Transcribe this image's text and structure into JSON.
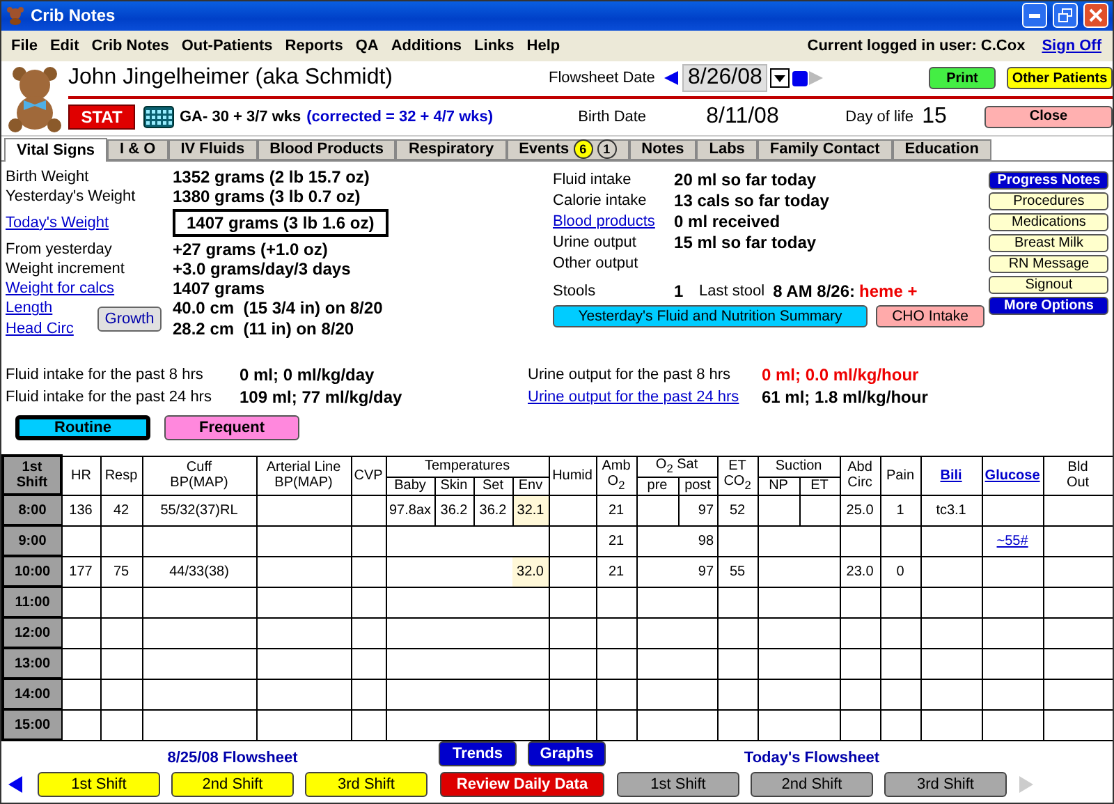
{
  "window": {
    "title": "Crib Notes"
  },
  "menu": {
    "items": [
      "File",
      "Edit",
      "Crib Notes",
      "Out-Patients",
      "Reports",
      "QA",
      "Additions",
      "Links",
      "Help"
    ],
    "user": "Current logged in user: C.Cox",
    "sign_off": "Sign Off"
  },
  "patient": {
    "name": "John Jingelheimer (aka Schmidt)",
    "stat": "STAT",
    "ga": "GA- 30 + 3/7 wks",
    "corrected": "(corrected = 32 + 4/7 wks)",
    "flowsheet_label": "Flowsheet Date",
    "flowsheet_date": "8/26/08",
    "birth_label": "Birth Date",
    "birth_date": "8/11/08",
    "dol_label": "Day of life",
    "dol": "15",
    "print": "Print",
    "other_patients": "Other Patients",
    "close": "Close"
  },
  "tabs": [
    {
      "label": "Vital Signs",
      "selected": true
    },
    {
      "label": "I & O",
      "selected": false
    },
    {
      "label": "IV Fluids",
      "selected": false
    },
    {
      "label": "Blood Products",
      "selected": false
    },
    {
      "label": "Respiratory",
      "selected": false
    },
    {
      "label": "Events",
      "selected": false,
      "badges": [
        {
          "text": "6",
          "color": "#ffff00"
        },
        {
          "text": "1",
          "color": "#d4d0c8"
        }
      ]
    },
    {
      "label": "Notes",
      "selected": false
    },
    {
      "label": "Labs",
      "selected": false
    },
    {
      "label": "Family Contact",
      "selected": false
    },
    {
      "label": "Education",
      "selected": false
    }
  ],
  "weights": [
    {
      "label": "Birth Weight",
      "value": "1352 grams (2 lb 15.7 oz)",
      "link": false,
      "boxed": false
    },
    {
      "label": "Yesterday's Weight",
      "value": "1380 grams (3 lb 0.7 oz)",
      "link": false,
      "boxed": false
    },
    {
      "label": "Today's Weight",
      "value": "1407 grams (3 lb 1.6 oz)",
      "link": true,
      "boxed": true
    },
    {
      "label": "From yesterday",
      "value": "+27 grams (+1.0 oz)",
      "link": false,
      "boxed": false
    },
    {
      "label": "Weight increment",
      "value": "+3.0 grams/day/3 days",
      "link": false,
      "boxed": false
    },
    {
      "label": "Weight for calcs",
      "value": "1407 grams",
      "link": true,
      "boxed": false
    }
  ],
  "measurements": {
    "button": "Growth",
    "rows": [
      {
        "label": "Length",
        "value": "40.0 cm  (15 3/4 in) on 8/20"
      },
      {
        "label": "Head Circ",
        "value": "28.2 cm  (11 in) on 8/20"
      }
    ]
  },
  "intake": [
    {
      "label": "Fluid intake",
      "value": "20 ml so far today",
      "link": false
    },
    {
      "label": "Calorie intake",
      "value": "13 cals so far today",
      "link": false
    },
    {
      "label": "Blood products",
      "value": "0 ml received",
      "link": true
    },
    {
      "label": "Urine output",
      "value": "15 ml so far today",
      "link": false
    },
    {
      "label": "Other output",
      "link": false
    }
  ],
  "stools": {
    "label": "Stools",
    "count": "1",
    "last_label": "Last stool",
    "last_time": "8 AM 8/26:",
    "last_note": "heme +"
  },
  "summary_buttons": [
    {
      "label": "Yesterday's Fluid and Nutrition Summary",
      "color": "#00ccff"
    },
    {
      "label": "CHO Intake",
      "color": "#ffaaaa"
    }
  ],
  "side_buttons": [
    {
      "label": "Progress Notes",
      "color": "#0000cc"
    },
    {
      "label": "Procedures",
      "color": "#ffffcc"
    },
    {
      "label": "Medications",
      "color": "#ffffcc"
    },
    {
      "label": "Breast Milk",
      "color": "#ffffcc"
    },
    {
      "label": "RN Message",
      "color": "#ffffcc"
    },
    {
      "label": "Signout",
      "color": "#ffffcc"
    },
    {
      "label": "More Options",
      "color": "#0000cc"
    }
  ],
  "totals": [
    {
      "label": "Fluid intake for the past 8 hrs",
      "value": "0 ml; 0 ml/kg/day",
      "link": false,
      "alert": false
    },
    {
      "label": "Urine output for the past 8 hrs",
      "value": "0 ml; 0.0 ml/kg/hour",
      "link": false,
      "alert": true
    },
    {
      "label": "Fluid intake for the past 24 hrs",
      "value": "109 ml; 77 ml/kg/day",
      "link": false,
      "alert": false
    },
    {
      "label": "Urine output for the past 24 hrs",
      "value": "61 ml; 1.8 ml/kg/hour",
      "link": true,
      "alert": false
    }
  ],
  "modes": [
    {
      "label": "Routine",
      "color": "#00ccff",
      "selected": true
    },
    {
      "label": "Frequent",
      "color": "#ff88dd",
      "selected": false
    }
  ],
  "table": {
    "columns": [
      {
        "label": "HR"
      },
      {
        "label": "Resp"
      },
      {
        "label": "Cuff\nBP(MAP)"
      },
      {
        "label": "Arterial Line\nBP(MAP)"
      },
      {
        "label": "CVP"
      },
      {
        "label": "Temperatures",
        "sub": [
          {
            "label": "Baby"
          },
          {
            "label": "Skin"
          },
          {
            "label": "Set"
          },
          {
            "label": "Env",
            "highlight": true
          }
        ]
      },
      {
        "label": "Humid"
      },
      {
        "label": "Amb\nO$_{2}$"
      },
      {
        "label": "O$_{2}$ Sat",
        "sub": [
          {
            "label": "pre"
          },
          {
            "label": "post"
          }
        ]
      },
      {
        "label": "ET\nCO$_{2}$"
      },
      {
        "label": "Suction",
        "sub": [
          {
            "label": "NP"
          },
          {
            "label": "ET"
          }
        ]
      },
      {
        "label": "Abd\nCirc"
      },
      {
        "label": "Pain"
      },
      {
        "label": "Bili",
        "header_link": true
      },
      {
        "label": "Glucose",
        "header_link": true,
        "value_link": true
      },
      {
        "label": "Bld\nOut"
      }
    ],
    "shift_label": "1st\nShift",
    "rows": [
      {
        "time": "8:00",
        "split": true,
        "cells": [
          {
            "kind": "hr",
            "text": "136"
          },
          {
            "kind": "resp",
            "text": "42"
          },
          {
            "kind": "cuff",
            "text": "55/32(37)RL"
          },
          {
            "kind": "baby",
            "text": "97.8ax"
          },
          {
            "kind": "skin",
            "text": "36.2"
          },
          {
            "kind": "set",
            "text": "36.2"
          },
          {
            "kind": "env",
            "text": "32.1"
          },
          {
            "kind": "amb",
            "text": "21"
          },
          {
            "kind": "post",
            "text": "97"
          },
          {
            "kind": "co2",
            "text": "52"
          },
          {
            "kind": "abd",
            "text": "25.0"
          },
          {
            "kind": "pain",
            "text": "1"
          },
          {
            "kind": "bili",
            "text": "tc3.1"
          }
        ]
      },
      {
        "time": "9:00",
        "split": false,
        "cells": [
          {
            "kind": "amb",
            "text": "21"
          },
          {
            "kind": "post",
            "text": "98"
          },
          {
            "kind": "glucose",
            "text": "~55#"
          }
        ]
      },
      {
        "time": "10:00",
        "split": false,
        "cells": [
          {
            "kind": "hr",
            "text": "177"
          },
          {
            "kind": "resp",
            "text": "75"
          },
          {
            "kind": "cuff",
            "text": "44/33(38)"
          },
          {
            "kind": "env",
            "text": "32.0"
          },
          {
            "kind": "amb",
            "text": "21"
          },
          {
            "kind": "post",
            "text": "97"
          },
          {
            "kind": "co2",
            "text": "55"
          },
          {
            "kind": "abd",
            "text": "23.0"
          },
          {
            "kind": "pain",
            "text": "0"
          }
        ]
      },
      {
        "time": "11:00",
        "split": false
      },
      {
        "time": "12:00",
        "split": false
      },
      {
        "time": "13:00",
        "split": false
      },
      {
        "time": "14:00",
        "split": false
      },
      {
        "time": "15:00",
        "split": false
      }
    ]
  },
  "footer": {
    "previous_label": "8/25/08 Flowsheet",
    "previous_shifts": [
      "1st Shift",
      "2nd Shift",
      "3rd Shift"
    ],
    "middle": [
      {
        "label": "Trends",
        "color": "#0000cc"
      },
      {
        "label": "Graphs",
        "color": "#0000cc"
      }
    ],
    "review": "Review Daily Data",
    "today_label": "Today's Flowsheet",
    "today_shifts": [
      "1st Shift",
      "2nd Shift",
      "3rd Shift"
    ]
  }
}
